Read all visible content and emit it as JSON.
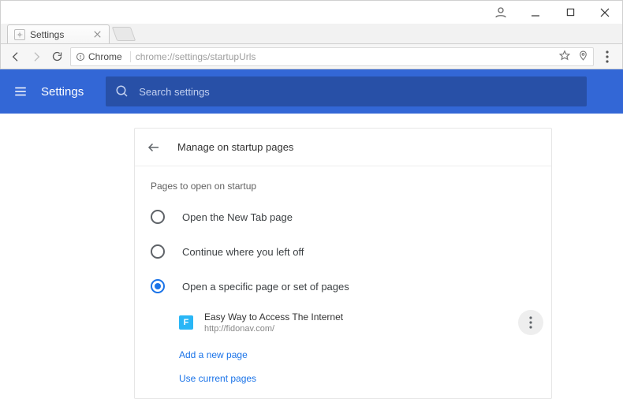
{
  "window": {
    "tab_title": "Settings"
  },
  "omnibox": {
    "scheme_label": "Chrome",
    "url_path": "chrome://settings/startupUrls"
  },
  "header": {
    "title": "Settings",
    "search_placeholder": "Search settings"
  },
  "card": {
    "title": "Manage on startup pages",
    "section_label": "Pages to open on startup",
    "options": [
      {
        "label": "Open the New Tab page"
      },
      {
        "label": "Continue where you left off"
      },
      {
        "label": "Open a specific page or set of pages"
      }
    ],
    "entry": {
      "favicon_letter": "F",
      "title": "Easy Way to Access The Internet",
      "url": "http://fidonav.com/"
    },
    "add_link": "Add a new page",
    "use_current_link": "Use current pages"
  }
}
